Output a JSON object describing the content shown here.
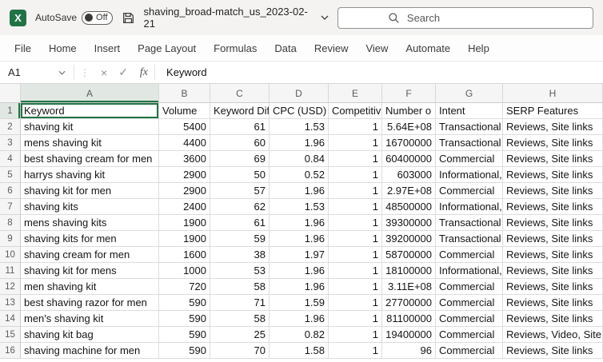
{
  "colors": {
    "accent_green": "#217346",
    "grid_line": "#dcdcdc",
    "header_bg": "#f5f5f5",
    "selected_header_bg": "#e1e8e3",
    "titlebar_bg": "#f4f3f2"
  },
  "titlebar": {
    "autosave_label": "AutoSave",
    "autosave_state": "Off",
    "filename": "shaving_broad-match_us_2023-02-21",
    "search_placeholder": "Search"
  },
  "menu": {
    "items": [
      "File",
      "Home",
      "Insert",
      "Page Layout",
      "Formulas",
      "Data",
      "Review",
      "View",
      "Automate",
      "Help"
    ]
  },
  "formula_bar": {
    "name_box": "A1",
    "grip": "⋮",
    "cancel": "×",
    "confirm": "✓",
    "fx_label": "fx",
    "content": "Keyword"
  },
  "sheet": {
    "selected_cell": "A1",
    "columns": [
      "A",
      "B",
      "C",
      "D",
      "E",
      "F",
      "G",
      "H"
    ],
    "rows": [
      [
        "Keyword",
        "Volume",
        "Keyword Diff",
        "CPC (USD)",
        "Competitiv",
        "Number o",
        "Intent",
        "SERP Features"
      ],
      [
        "shaving kit",
        "5400",
        "61",
        "1.53",
        "1",
        "5.64E+08",
        "Transactional",
        "Reviews, Site links"
      ],
      [
        "mens shaving kit",
        "4400",
        "60",
        "1.96",
        "1",
        "16700000",
        "Transactional",
        "Reviews, Site links"
      ],
      [
        "best shaving cream for men",
        "3600",
        "69",
        "0.84",
        "1",
        "60400000",
        "Commercial",
        "Reviews, Site links"
      ],
      [
        "harrys shaving kit",
        "2900",
        "50",
        "0.52",
        "1",
        "603000",
        "Informational,",
        "Reviews, Site links"
      ],
      [
        "shaving kit for men",
        "2900",
        "57",
        "1.96",
        "1",
        "2.97E+08",
        "Commercial",
        "Reviews, Site links"
      ],
      [
        "shaving kits",
        "2400",
        "62",
        "1.53",
        "1",
        "48500000",
        "Informational,",
        "Reviews, Site links"
      ],
      [
        "mens shaving kits",
        "1900",
        "61",
        "1.96",
        "1",
        "39300000",
        "Transactional",
        "Reviews, Site links"
      ],
      [
        "shaving kits for men",
        "1900",
        "59",
        "1.96",
        "1",
        "39200000",
        "Transactional",
        "Reviews, Site links"
      ],
      [
        "shaving cream for men",
        "1600",
        "38",
        "1.97",
        "1",
        "58700000",
        "Commercial",
        "Reviews, Site links"
      ],
      [
        "shaving kit for mens",
        "1000",
        "53",
        "1.96",
        "1",
        "18100000",
        "Informational,",
        "Reviews, Site links"
      ],
      [
        "men shaving kit",
        "720",
        "58",
        "1.96",
        "1",
        "3.11E+08",
        "Commercial",
        "Reviews, Site links"
      ],
      [
        "best shaving razor for men",
        "590",
        "71",
        "1.59",
        "1",
        "27700000",
        "Commercial",
        "Reviews, Site links"
      ],
      [
        "men's shaving kit",
        "590",
        "58",
        "1.96",
        "1",
        "81100000",
        "Commercial",
        "Reviews, Site links"
      ],
      [
        "shaving kit bag",
        "590",
        "25",
        "0.82",
        "1",
        "19400000",
        "Commercial",
        "Reviews, Video, Site links"
      ],
      [
        "shaving machine for men",
        "590",
        "70",
        "1.58",
        "1",
        "96",
        "Commercial",
        "Reviews, Site links"
      ]
    ]
  }
}
